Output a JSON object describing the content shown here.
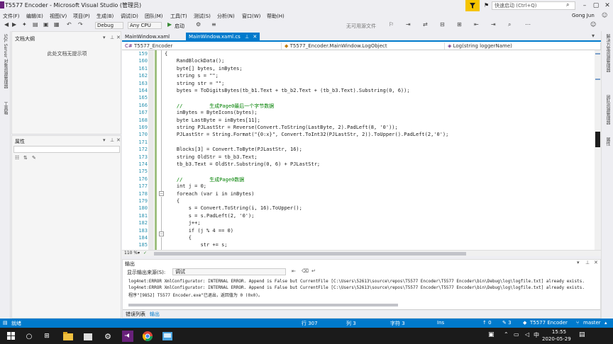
{
  "window": {
    "title": "T5577 Encoder - Microsoft Visual Studio (管理员)",
    "search_placeholder": "快速启动 (Ctrl+Q)",
    "user": "Gong Jun",
    "colors": {
      "accent": "#007acc",
      "filter": "#f5c400",
      "vs_purple": "#68217a"
    }
  },
  "menu": [
    "文件(F)",
    "编辑(E)",
    "视图(V)",
    "项目(P)",
    "生成(B)",
    "调试(D)",
    "团队(M)",
    "工具(T)",
    "测试(S)",
    "分析(N)",
    "窗口(W)",
    "帮助(H)"
  ],
  "toolbar": {
    "config": "Debug",
    "platform": "Any CPU",
    "start": "启动",
    "start_icon": "play-icon",
    "right_text": "无可用源文件"
  },
  "left_strip_labels": [
    "SQL Server 对象资源管理器",
    "工具箱"
  ],
  "right_strip_labels": [
    "解决方案资源管理器",
    "团队资源管理器",
    "属性"
  ],
  "solution_pane": {
    "title": "文档大纲",
    "empty_text": "此处文档无提示项"
  },
  "properties_pane": {
    "title": "属性"
  },
  "editor": {
    "tabs": [
      {
        "label": "MainWindow.xaml",
        "active": false
      },
      {
        "label": "MainWindow.xaml.cs",
        "active": true
      }
    ],
    "nav": [
      "T5577_Encoder",
      "T5577_Encoder.MainWindow.LogObject",
      "Log(string loggerName)"
    ],
    "zoom": "110 %",
    "lines": [
      {
        "n": "159",
        "t": "{"
      },
      {
        "n": "160",
        "t": "    RandBlockData();"
      },
      {
        "n": "161",
        "t": "    byte[] bytes, inBytes;"
      },
      {
        "n": "162",
        "t": "    string s = \"\";"
      },
      {
        "n": "163",
        "t": "    string str = \"\";"
      },
      {
        "n": "164",
        "t": "    bytes = ToDigitsBytes(tb_b1.Text + tb_b2.Text + (tb_b3.Text).Substring(0, 6));"
      },
      {
        "n": "165",
        "t": ""
      },
      {
        "n": "166",
        "t": "    //         生成Page0最后一个字节数据"
      },
      {
        "n": "167",
        "t": "    inBytes = ByteIcons(bytes);"
      },
      {
        "n": "168",
        "t": "    byte LastByte = inBytes[11];"
      },
      {
        "n": "169",
        "t": "    string PJLastStr = Reverse(Convert.ToString(LastByte, 2).PadLeft(8, '0'));"
      },
      {
        "n": "170",
        "t": "    PJLastStr = String.Format(\"{0:x}\", Convert.ToInt32(PJLastStr, 2)).ToUpper().PadLeft(2,'0');"
      },
      {
        "n": "171",
        "t": ""
      },
      {
        "n": "172",
        "t": "    Blocks[3] = Convert.ToByte(PJLastStr, 16);"
      },
      {
        "n": "173",
        "t": "    string OldStr = tb_b3.Text;"
      },
      {
        "n": "174",
        "t": "    tb_b3.Text = OldStr.Substring(0, 6) + PJLastStr;"
      },
      {
        "n": "175",
        "t": ""
      },
      {
        "n": "176",
        "t": "    //         生成Page0数据"
      },
      {
        "n": "177",
        "t": "    int j = 0;"
      },
      {
        "n": "178",
        "t": "    foreach (var i in inBytes)"
      },
      {
        "n": "179",
        "t": "    {"
      },
      {
        "n": "180",
        "t": "        s = Convert.ToString(i, 16).ToUpper();"
      },
      {
        "n": "181",
        "t": "        s = s.PadLeft(2, '0');"
      },
      {
        "n": "182",
        "t": "        j++;"
      },
      {
        "n": "183",
        "t": "        if (j % 4 == 0)"
      },
      {
        "n": "184",
        "t": "        {"
      },
      {
        "n": "185",
        "t": "            str += s;"
      }
    ]
  },
  "output": {
    "title": "输出",
    "source_label": "显示输出来源(S):",
    "source_value": "调试",
    "lines": [
      "log4net:ERROR XmlConfigurator: INTERNAL ERROR. Append is False but CurrentFile [C:\\Users\\52613\\source\\repos\\T5577 Encoder\\T5577 Encoder\\bin\\Debug\\log\\logfile.txt] already exists.",
      "log4net:ERROR XmlConfigurator: INTERNAL ERROR. Append is False but CurrentFile [C:\\Users\\52613\\source\\repos\\T5577 Encoder\\T5577 Encoder\\bin\\Debug\\log\\logfile.txt] already exists.",
      "程序\"[9852] T5577 Encoder.exe\"已退出，返回值为 0 (0x0)。"
    ],
    "tabs": [
      "错误列表",
      "输出"
    ]
  },
  "status": {
    "left": "就绪",
    "line": "行 307",
    "col": "列 3",
    "ch": "字符 3",
    "mode": "Ins",
    "arrows": "↑ 0",
    "pencil": "✎ 3",
    "project": "T5577 Encoder",
    "branch": "master"
  },
  "taskbar": {
    "time": "15:55",
    "date": "2020-05-29",
    "ime": "中"
  }
}
